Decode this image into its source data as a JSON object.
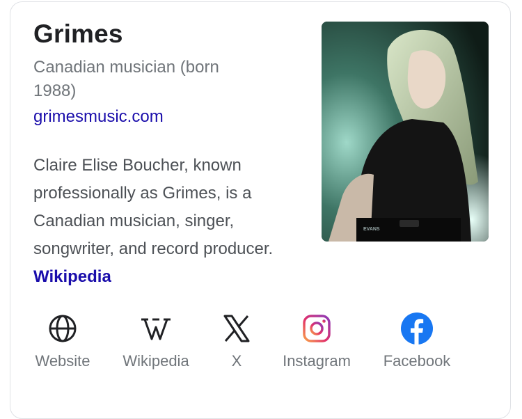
{
  "entity": {
    "name": "Grimes",
    "subtitle": "Canadian musician (born 1988)",
    "website_link": "grimesmusic.com",
    "description": "Claire Elise Boucher, known professionally as Grimes, is a Canadian musician, singer, songwriter, and record producer.",
    "description_source": "Wikipedia"
  },
  "photo": {
    "icon": "performer-photo"
  },
  "profiles": [
    {
      "label": "Website",
      "icon": "globe-icon"
    },
    {
      "label": "Wikipedia",
      "icon": "wikipedia-icon"
    },
    {
      "label": "X",
      "icon": "x-logo-icon"
    },
    {
      "label": "Instagram",
      "icon": "instagram-icon"
    },
    {
      "label": "Facebook",
      "icon": "facebook-icon"
    }
  ],
  "colors": {
    "link": "#1a0dab",
    "facebook": "#1877f2",
    "muted": "#70757a"
  }
}
